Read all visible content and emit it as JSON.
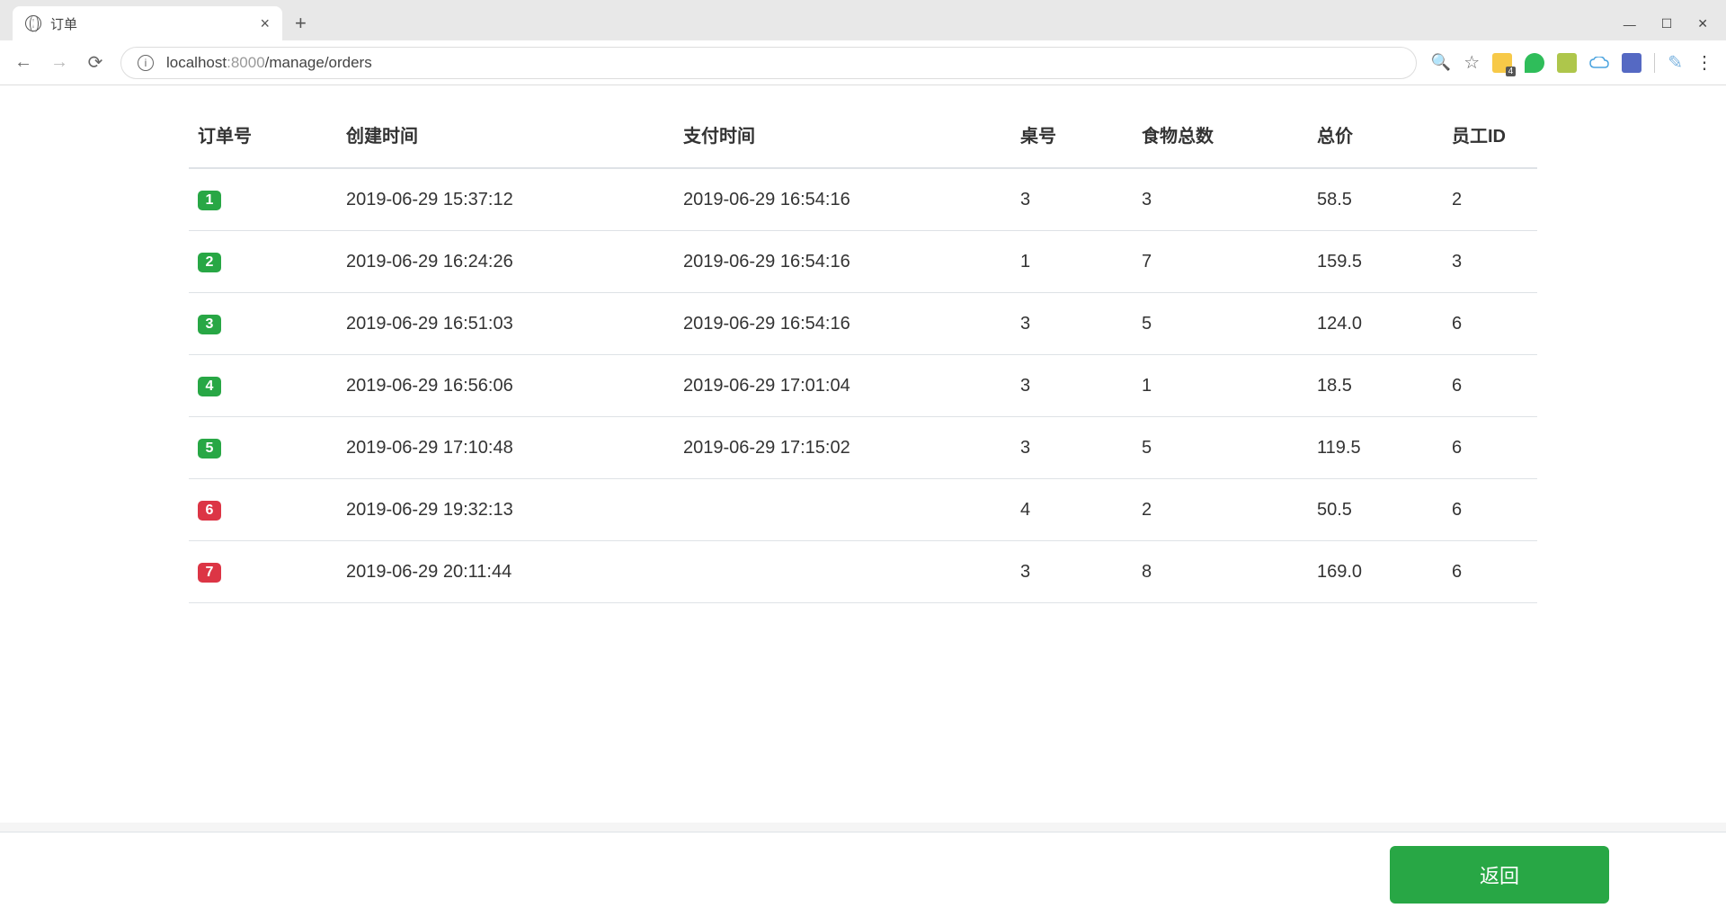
{
  "browser": {
    "tab_title": "订单",
    "url_host": "localhost",
    "url_port": ":8000",
    "url_path": "/manage/orders",
    "ext_badge": "4"
  },
  "table": {
    "headers": {
      "order_id": "订单号",
      "created": "创建时间",
      "paid": "支付时间",
      "table_no": "桌号",
      "food_total": "食物总数",
      "price": "总价",
      "employee": "员工ID"
    },
    "rows": [
      {
        "id": "1",
        "status": "green",
        "created": "2019-06-29 15:37:12",
        "paid": "2019-06-29 16:54:16",
        "table_no": "3",
        "food_total": "3",
        "price": "58.5",
        "employee": "2"
      },
      {
        "id": "2",
        "status": "green",
        "created": "2019-06-29 16:24:26",
        "paid": "2019-06-29 16:54:16",
        "table_no": "1",
        "food_total": "7",
        "price": "159.5",
        "employee": "3"
      },
      {
        "id": "3",
        "status": "green",
        "created": "2019-06-29 16:51:03",
        "paid": "2019-06-29 16:54:16",
        "table_no": "3",
        "food_total": "5",
        "price": "124.0",
        "employee": "6"
      },
      {
        "id": "4",
        "status": "green",
        "created": "2019-06-29 16:56:06",
        "paid": "2019-06-29 17:01:04",
        "table_no": "3",
        "food_total": "1",
        "price": "18.5",
        "employee": "6"
      },
      {
        "id": "5",
        "status": "green",
        "created": "2019-06-29 17:10:48",
        "paid": "2019-06-29 17:15:02",
        "table_no": "3",
        "food_total": "5",
        "price": "119.5",
        "employee": "6"
      },
      {
        "id": "6",
        "status": "red",
        "created": "2019-06-29 19:32:13",
        "paid": "",
        "table_no": "4",
        "food_total": "2",
        "price": "50.5",
        "employee": "6"
      },
      {
        "id": "7",
        "status": "red",
        "created": "2019-06-29 20:11:44",
        "paid": "",
        "table_no": "3",
        "food_total": "8",
        "price": "169.0",
        "employee": "6"
      }
    ]
  },
  "footer": {
    "return_label": "返回"
  }
}
